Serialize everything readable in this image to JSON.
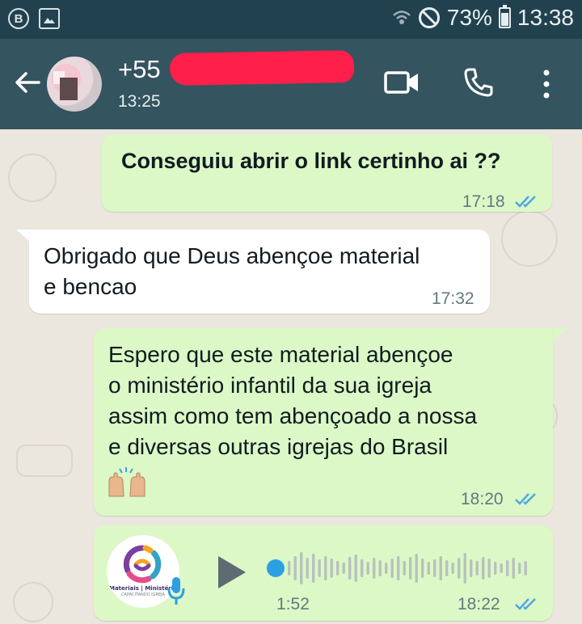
{
  "status_bar": {
    "left_icons": [
      "b-icon",
      "image-icon"
    ],
    "b_label": "B",
    "battery": "73%",
    "time": "13:38"
  },
  "header": {
    "contact_name": "+55",
    "last_seen": "13:25"
  },
  "messages": [
    {
      "direction": "out",
      "text": "Conseguiu abrir o link certinho ai ??",
      "time": "17:18",
      "status": "read"
    },
    {
      "direction": "in",
      "text": "Obrigado que Deus abençoe material\ne bencao",
      "time": "17:32"
    },
    {
      "direction": "out",
      "text": "Espero que este material abençoe\no ministério infantil da sua igreja\nassim como tem abençoado a nossa\ne diversas outras igrejas do Brasil",
      "emoji": "🙌🏼",
      "time": "18:20",
      "status": "read"
    },
    {
      "direction": "out",
      "type": "voice",
      "duration": "1:52",
      "time": "18:22",
      "status": "read",
      "avatar_logo_text": "Materiais | Ministério",
      "avatar_logo_sub": "CAPACITANDO IGREJA"
    }
  ],
  "colors": {
    "status_bar": "#21414f",
    "header": "#34545f",
    "outgoing_bubble": "#dcf8c6",
    "incoming_bubble": "#ffffff",
    "read_ticks": "#4fa6e6",
    "redaction": "#ff1f4a"
  }
}
